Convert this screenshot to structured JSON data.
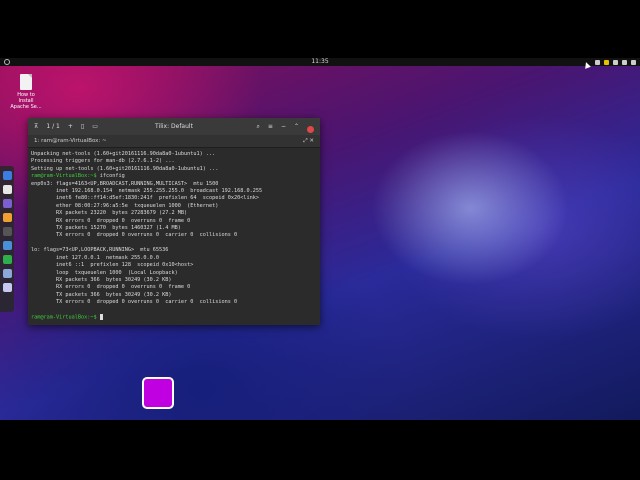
{
  "topbar": {
    "clock": "11:35"
  },
  "desktop_icon": {
    "label": "How to Install Apache Se..."
  },
  "terminal": {
    "title": "Tilix: Default",
    "session_counter": "1 / 1",
    "tab_label": "1: ram@ram-VirtualBox: ~",
    "lines": [
      "Unpacking net-tools (1.60+git20161116.90da8a0-1ubuntu1) ...",
      "Processing triggers for man-db (2.7.6.1-2) ...",
      "Setting up net-tools (1.60+git20161116.90da8a0-1ubuntu1) ...",
      "ram@ram-VirtualBox:~$ ifconfig",
      "enp0s3: flags=4163<UP,BROADCAST,RUNNING,MULTICAST>  mtu 1500",
      "        inet 192.168.0.154  netmask 255.255.255.0  broadcast 192.168.0.255",
      "        inet6 fe80::ff14:d5ef:1830:241f  prefixlen 64  scopeid 0x20<link>",
      "        ether 08:00:27:96:a5:5e  txqueuelen 1000  (Ethernet)",
      "        RX packets 23220  bytes 27283679 (27.2 MB)",
      "        RX errors 0  dropped 0  overruns 0  frame 0",
      "        TX packets 15270  bytes 1460327 (1.4 MB)",
      "        TX errors 0  dropped 0 overruns 0  carrier 0  collisions 0",
      "",
      "lo: flags=73<UP,LOOPBACK,RUNNING>  mtu 65536",
      "        inet 127.0.0.1  netmask 255.0.0.0",
      "        inet6 ::1  prefixlen 128  scopeid 0x10<host>",
      "        loop  txqueuelen 1000  (Local Loopback)",
      "        RX packets 366  bytes 30249 (30.2 KB)",
      "        RX errors 0  dropped 0  overruns 0  frame 0",
      "        TX packets 366  bytes 30249 (30.2 KB)",
      "        TX errors 0  dropped 0 overruns 0  carrier 0  collisions 0",
      ""
    ],
    "prompt": "ram@ram-VirtualBox:~$ "
  },
  "colors": {
    "prompt": "#3ecf3e",
    "accent_square": "#c000e0",
    "close": "#e04848"
  }
}
